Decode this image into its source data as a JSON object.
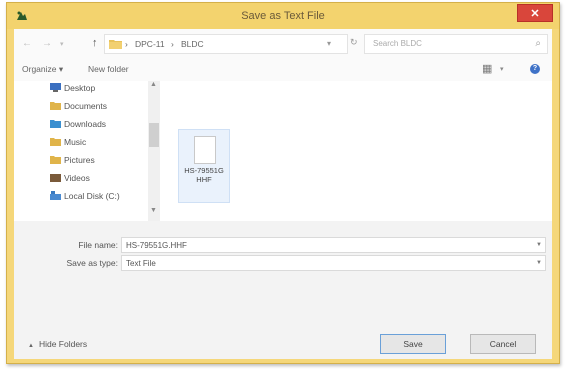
{
  "window": {
    "title": "Save as Text File",
    "close_label": "✕"
  },
  "address_bar": {
    "crumbs": [
      "DPC-11",
      "BLDC"
    ],
    "search_placeholder": "Search BLDC"
  },
  "toolbar": {
    "organize_label": "Organize ▾",
    "new_folder_label": "New folder"
  },
  "nav_pane": {
    "items": [
      {
        "label": "Desktop",
        "icon": "desktop-icon",
        "color": "#3a6fc0"
      },
      {
        "label": "Documents",
        "icon": "documents-icon",
        "color": "#e0b44a"
      },
      {
        "label": "Downloads",
        "icon": "downloads-icon",
        "color": "#3a8fd0"
      },
      {
        "label": "Music",
        "icon": "music-icon",
        "color": "#e0b44a"
      },
      {
        "label": "Pictures",
        "icon": "pictures-icon",
        "color": "#e0b44a"
      },
      {
        "label": "Videos",
        "icon": "videos-icon",
        "color": "#7a5a3a"
      },
      {
        "label": "Local Disk (C:)",
        "icon": "drive-icon",
        "color": "#4a8ad0"
      }
    ]
  },
  "files": [
    {
      "name": "HS-79551G HHF"
    }
  ],
  "form": {
    "file_name_label": "File name:",
    "file_name_value": "HS-79551G.HHF",
    "save_type_label": "Save as type:",
    "save_type_value": "Text File"
  },
  "footer": {
    "hide_folders_label": "Hide Folders",
    "save_label": "Save",
    "cancel_label": "Cancel"
  },
  "colors": {
    "titlebar": "#f3d36e",
    "close": "#d9463b",
    "accent": "#3f72c7"
  }
}
